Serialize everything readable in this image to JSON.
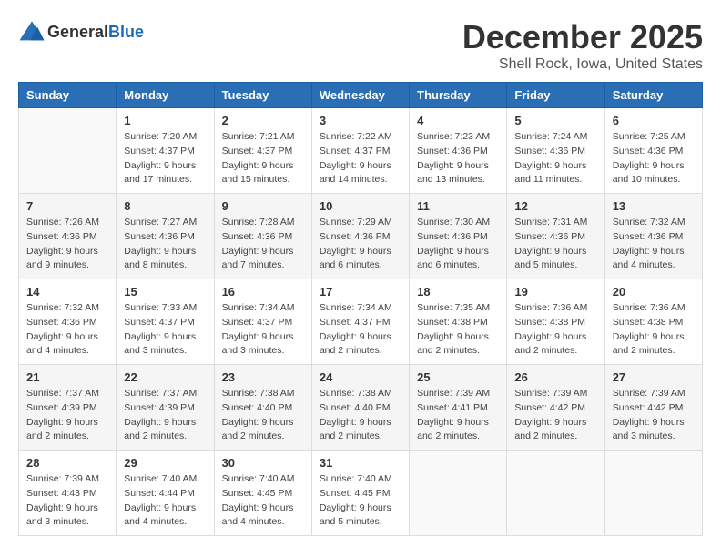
{
  "header": {
    "logo_general": "General",
    "logo_blue": "Blue",
    "month": "December 2025",
    "location": "Shell Rock, Iowa, United States"
  },
  "days_of_week": [
    "Sunday",
    "Monday",
    "Tuesday",
    "Wednesday",
    "Thursday",
    "Friday",
    "Saturday"
  ],
  "weeks": [
    [
      {
        "day": "",
        "info": ""
      },
      {
        "day": "1",
        "info": "Sunrise: 7:20 AM\nSunset: 4:37 PM\nDaylight: 9 hours\nand 17 minutes."
      },
      {
        "day": "2",
        "info": "Sunrise: 7:21 AM\nSunset: 4:37 PM\nDaylight: 9 hours\nand 15 minutes."
      },
      {
        "day": "3",
        "info": "Sunrise: 7:22 AM\nSunset: 4:37 PM\nDaylight: 9 hours\nand 14 minutes."
      },
      {
        "day": "4",
        "info": "Sunrise: 7:23 AM\nSunset: 4:36 PM\nDaylight: 9 hours\nand 13 minutes."
      },
      {
        "day": "5",
        "info": "Sunrise: 7:24 AM\nSunset: 4:36 PM\nDaylight: 9 hours\nand 11 minutes."
      },
      {
        "day": "6",
        "info": "Sunrise: 7:25 AM\nSunset: 4:36 PM\nDaylight: 9 hours\nand 10 minutes."
      }
    ],
    [
      {
        "day": "7",
        "info": "Sunrise: 7:26 AM\nSunset: 4:36 PM\nDaylight: 9 hours\nand 9 minutes."
      },
      {
        "day": "8",
        "info": "Sunrise: 7:27 AM\nSunset: 4:36 PM\nDaylight: 9 hours\nand 8 minutes."
      },
      {
        "day": "9",
        "info": "Sunrise: 7:28 AM\nSunset: 4:36 PM\nDaylight: 9 hours\nand 7 minutes."
      },
      {
        "day": "10",
        "info": "Sunrise: 7:29 AM\nSunset: 4:36 PM\nDaylight: 9 hours\nand 6 minutes."
      },
      {
        "day": "11",
        "info": "Sunrise: 7:30 AM\nSunset: 4:36 PM\nDaylight: 9 hours\nand 6 minutes."
      },
      {
        "day": "12",
        "info": "Sunrise: 7:31 AM\nSunset: 4:36 PM\nDaylight: 9 hours\nand 5 minutes."
      },
      {
        "day": "13",
        "info": "Sunrise: 7:32 AM\nSunset: 4:36 PM\nDaylight: 9 hours\nand 4 minutes."
      }
    ],
    [
      {
        "day": "14",
        "info": "Sunrise: 7:32 AM\nSunset: 4:36 PM\nDaylight: 9 hours\nand 4 minutes."
      },
      {
        "day": "15",
        "info": "Sunrise: 7:33 AM\nSunset: 4:37 PM\nDaylight: 9 hours\nand 3 minutes."
      },
      {
        "day": "16",
        "info": "Sunrise: 7:34 AM\nSunset: 4:37 PM\nDaylight: 9 hours\nand 3 minutes."
      },
      {
        "day": "17",
        "info": "Sunrise: 7:34 AM\nSunset: 4:37 PM\nDaylight: 9 hours\nand 2 minutes."
      },
      {
        "day": "18",
        "info": "Sunrise: 7:35 AM\nSunset: 4:38 PM\nDaylight: 9 hours\nand 2 minutes."
      },
      {
        "day": "19",
        "info": "Sunrise: 7:36 AM\nSunset: 4:38 PM\nDaylight: 9 hours\nand 2 minutes."
      },
      {
        "day": "20",
        "info": "Sunrise: 7:36 AM\nSunset: 4:38 PM\nDaylight: 9 hours\nand 2 minutes."
      }
    ],
    [
      {
        "day": "21",
        "info": "Sunrise: 7:37 AM\nSunset: 4:39 PM\nDaylight: 9 hours\nand 2 minutes."
      },
      {
        "day": "22",
        "info": "Sunrise: 7:37 AM\nSunset: 4:39 PM\nDaylight: 9 hours\nand 2 minutes."
      },
      {
        "day": "23",
        "info": "Sunrise: 7:38 AM\nSunset: 4:40 PM\nDaylight: 9 hours\nand 2 minutes."
      },
      {
        "day": "24",
        "info": "Sunrise: 7:38 AM\nSunset: 4:40 PM\nDaylight: 9 hours\nand 2 minutes."
      },
      {
        "day": "25",
        "info": "Sunrise: 7:39 AM\nSunset: 4:41 PM\nDaylight: 9 hours\nand 2 minutes."
      },
      {
        "day": "26",
        "info": "Sunrise: 7:39 AM\nSunset: 4:42 PM\nDaylight: 9 hours\nand 2 minutes."
      },
      {
        "day": "27",
        "info": "Sunrise: 7:39 AM\nSunset: 4:42 PM\nDaylight: 9 hours\nand 3 minutes."
      }
    ],
    [
      {
        "day": "28",
        "info": "Sunrise: 7:39 AM\nSunset: 4:43 PM\nDaylight: 9 hours\nand 3 minutes."
      },
      {
        "day": "29",
        "info": "Sunrise: 7:40 AM\nSunset: 4:44 PM\nDaylight: 9 hours\nand 4 minutes."
      },
      {
        "day": "30",
        "info": "Sunrise: 7:40 AM\nSunset: 4:45 PM\nDaylight: 9 hours\nand 4 minutes."
      },
      {
        "day": "31",
        "info": "Sunrise: 7:40 AM\nSunset: 4:45 PM\nDaylight: 9 hours\nand 5 minutes."
      },
      {
        "day": "",
        "info": ""
      },
      {
        "day": "",
        "info": ""
      },
      {
        "day": "",
        "info": ""
      }
    ]
  ]
}
